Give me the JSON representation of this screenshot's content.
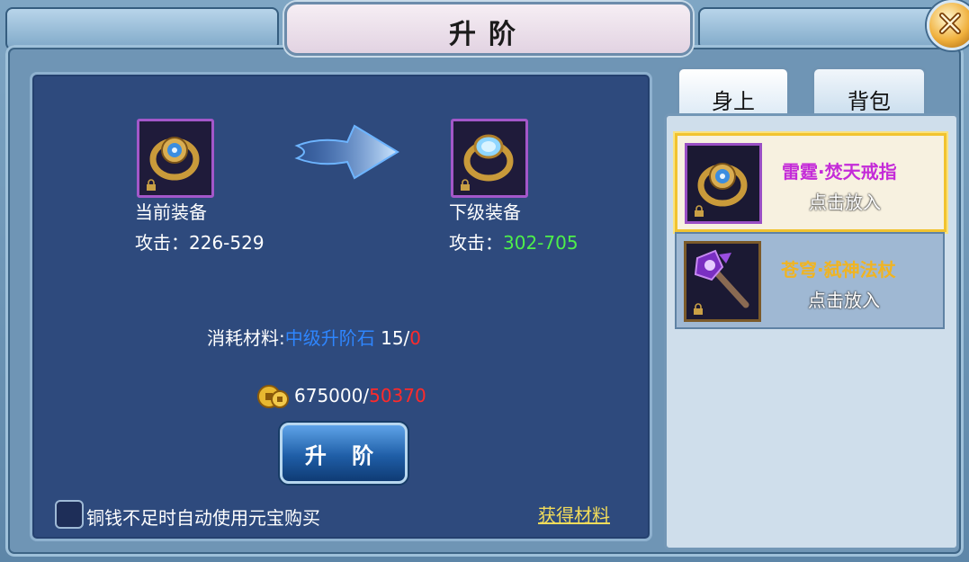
{
  "title": "升阶",
  "main": {
    "current_label": "当前装备",
    "current_attack_label": "攻击：",
    "current_attack_value": "226-529",
    "next_label": "下级装备",
    "next_attack_label": "攻击：",
    "next_attack_value": "302-705",
    "material_label": "消耗材料:",
    "material_name": "中级升阶石",
    "material_required": "15/",
    "material_owned": "0",
    "money_required": "675000/",
    "money_owned": "50370",
    "upgrade_button": "升 阶",
    "auto_buy_label": "铜钱不足时自动使用元宝购买",
    "get_material_link": "获得材料"
  },
  "tabs": [
    {
      "label": "身上"
    },
    {
      "label": "背包"
    }
  ],
  "items": [
    {
      "name": "雷霆·焚天戒指",
      "hint": "点击放入",
      "name_color": "#c42bd8"
    },
    {
      "name": "苍穹·弑神法杖",
      "hint": "点击放入",
      "name_color": "#f0b422"
    }
  ],
  "colors": {
    "attack_next": "#4ef04a",
    "material_name": "#2e86ff",
    "insufficient": "#ff2a2a",
    "link": "#f2dc5a"
  }
}
